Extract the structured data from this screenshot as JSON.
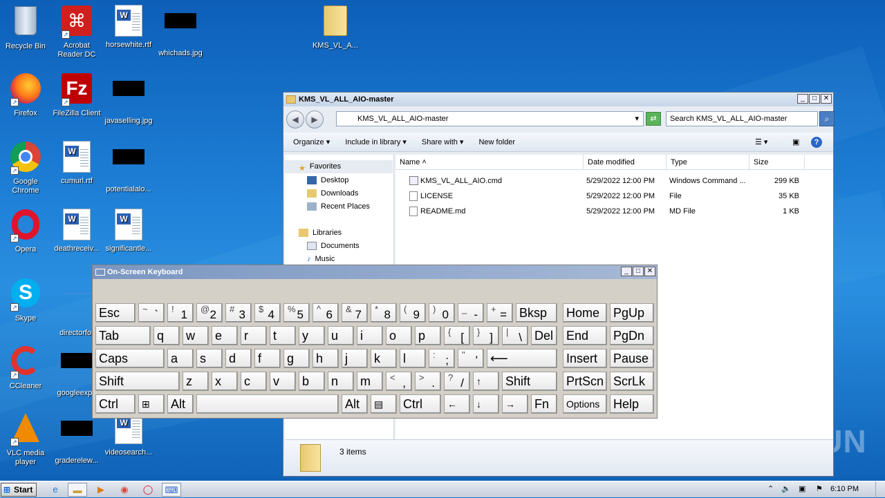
{
  "desktop": {
    "icons": [
      {
        "label": "Recycle Bin"
      },
      {
        "label": "Acrobat Reader DC"
      },
      {
        "label": "horsewhite.rtf"
      },
      {
        "label": "whichads.jpg"
      },
      {
        "label": "KMS_VL_A..."
      },
      {
        "label": "Firefox"
      },
      {
        "label": "FileZilla Client"
      },
      {
        "label": "javaselling.jpg"
      },
      {
        "label": "Google Chrome"
      },
      {
        "label": "cumurl.rtf"
      },
      {
        "label": "potentialalo..."
      },
      {
        "label": "Opera"
      },
      {
        "label": "deathreceiv..."
      },
      {
        "label": "significantle..."
      },
      {
        "label": "Skype"
      },
      {
        "label": "directorfor"
      },
      {
        "label": "CCleaner"
      },
      {
        "label": "googleexpe"
      },
      {
        "label": "VLC media player"
      },
      {
        "label": "graderelew..."
      },
      {
        "label": "videosearch..."
      }
    ]
  },
  "explorer": {
    "title": "KMS_VL_ALL_AIO-master",
    "path": "KMS_VL_ALL_AIO-master",
    "search_placeholder": "Search KMS_VL_ALL_AIO-master",
    "toolbar": {
      "organize": "Organize",
      "include": "Include in library",
      "share": "Share with",
      "newfolder": "New folder"
    },
    "nav": {
      "favorites": "Favorites",
      "desktop": "Desktop",
      "downloads": "Downloads",
      "recent": "Recent Places",
      "libraries": "Libraries",
      "documents": "Documents",
      "music": "Music"
    },
    "columns": {
      "name": "Name",
      "date": "Date modified",
      "type": "Type",
      "size": "Size"
    },
    "files": [
      {
        "name": "KMS_VL_ALL_AIO.cmd",
        "date": "5/29/2022 12:00 PM",
        "type": "Windows Command ...",
        "size": "299 KB"
      },
      {
        "name": "LICENSE",
        "date": "5/29/2022 12:00 PM",
        "type": "File",
        "size": "35 KB"
      },
      {
        "name": "README.md",
        "date": "5/29/2022 12:00 PM",
        "type": "MD File",
        "size": "1 KB"
      }
    ],
    "status": "3 items"
  },
  "osk": {
    "title": "On-Screen Keyboard",
    "keys": {
      "esc": "Esc",
      "bksp": "Bksp",
      "home": "Home",
      "pgup": "PgUp",
      "tab": "Tab",
      "del": "Del",
      "end": "End",
      "pgdn": "PgDn",
      "caps": "Caps",
      "insert": "Insert",
      "pause": "Pause",
      "shift": "Shift",
      "shift2": "Shift",
      "prtscn": "PrtScn",
      "scrlk": "ScrLk",
      "ctrl": "Ctrl",
      "alt": "Alt",
      "alt2": "Alt",
      "ctrl2": "Ctrl",
      "fn": "Fn",
      "options": "Options",
      "help": "Help"
    }
  },
  "taskbar": {
    "start": "Start",
    "clock": "6:10 PM"
  },
  "watermark": "ANY RUN"
}
